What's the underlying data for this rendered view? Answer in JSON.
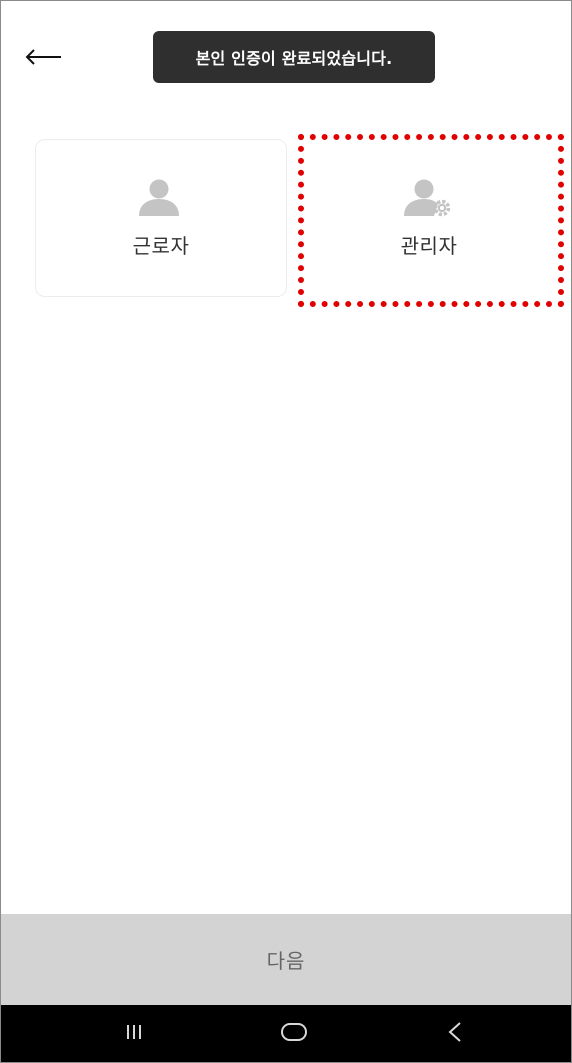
{
  "header": {
    "back_icon": "arrow-left-icon"
  },
  "toast": {
    "message": "본인 인증이 완료되었습니다."
  },
  "role_options": [
    {
      "label": "근로자",
      "icon": "person-icon"
    },
    {
      "label": "관리자",
      "icon": "person-gear-icon"
    }
  ],
  "footer": {
    "next_label": "다음"
  },
  "system_nav": {
    "recents_icon": "recents-icon",
    "home_icon": "home-icon",
    "back_icon": "back-chevron-icon"
  },
  "colors": {
    "toast_bg": "#2f2f2f",
    "icon_gray": "#c4c4c4",
    "highlight": "#e10000",
    "next_bar_bg": "#d3d3d3",
    "nav_bar_bg": "#000000"
  }
}
